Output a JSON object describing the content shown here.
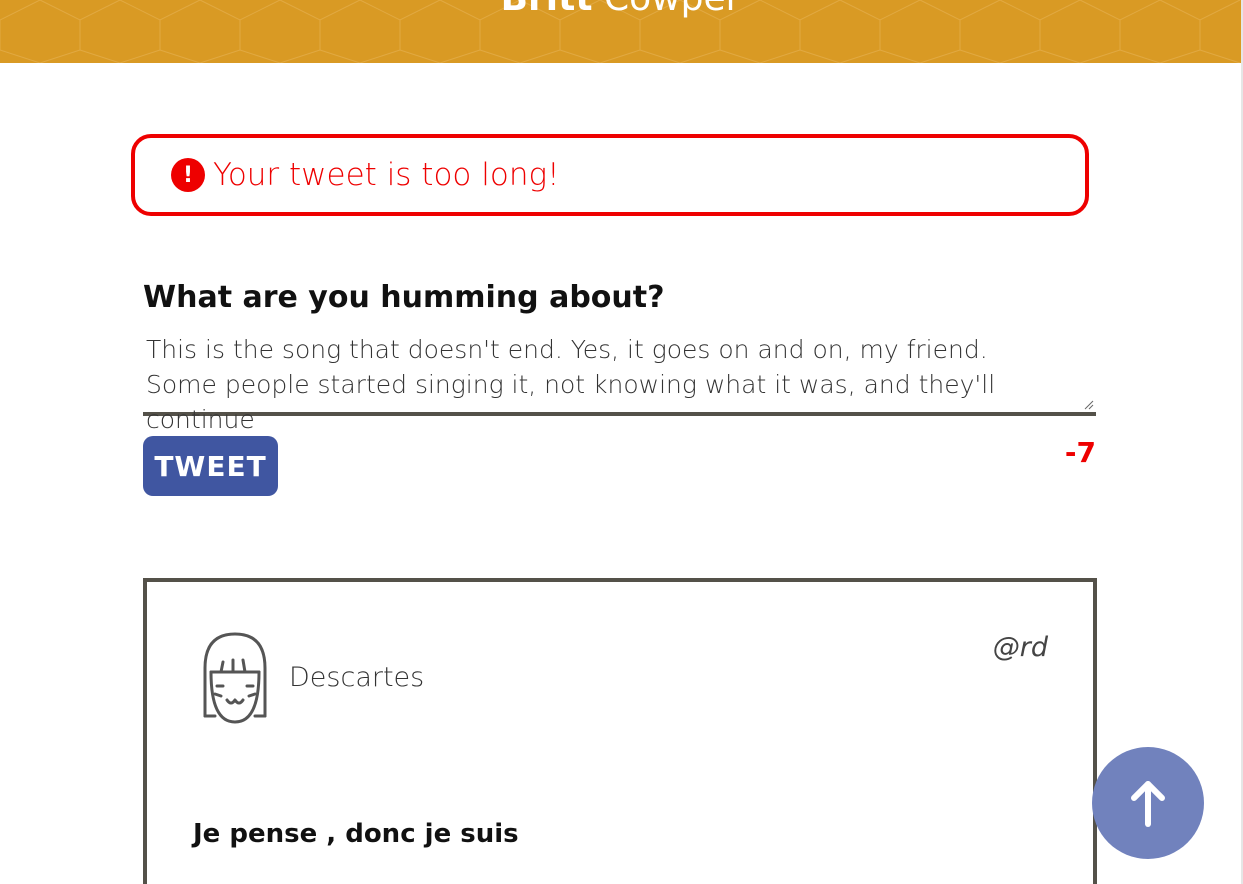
{
  "header": {
    "first_name": "Britt",
    "last_name": "Cowper",
    "background_color": "#d99a24"
  },
  "error": {
    "icon": "exclamation-circle-icon",
    "message": "Your tweet is too long!",
    "color": "#ee0000"
  },
  "compose": {
    "label": "What are you humming about?",
    "text_value": "This is the song that doesn't end. Yes, it goes on and on, my friend. Some people started singing it, not knowing what it was, and they'll continue",
    "button_label": "TWEET",
    "button_color": "#4056a1",
    "counter": "-7"
  },
  "tweet": {
    "avatar_icon": "girl-face-avatar-icon",
    "name": "Descartes",
    "handle": "@rd",
    "content": "Je pense , donc je suis"
  },
  "scroll_top": {
    "icon": "arrow-up-icon",
    "color": "#7182bd"
  }
}
